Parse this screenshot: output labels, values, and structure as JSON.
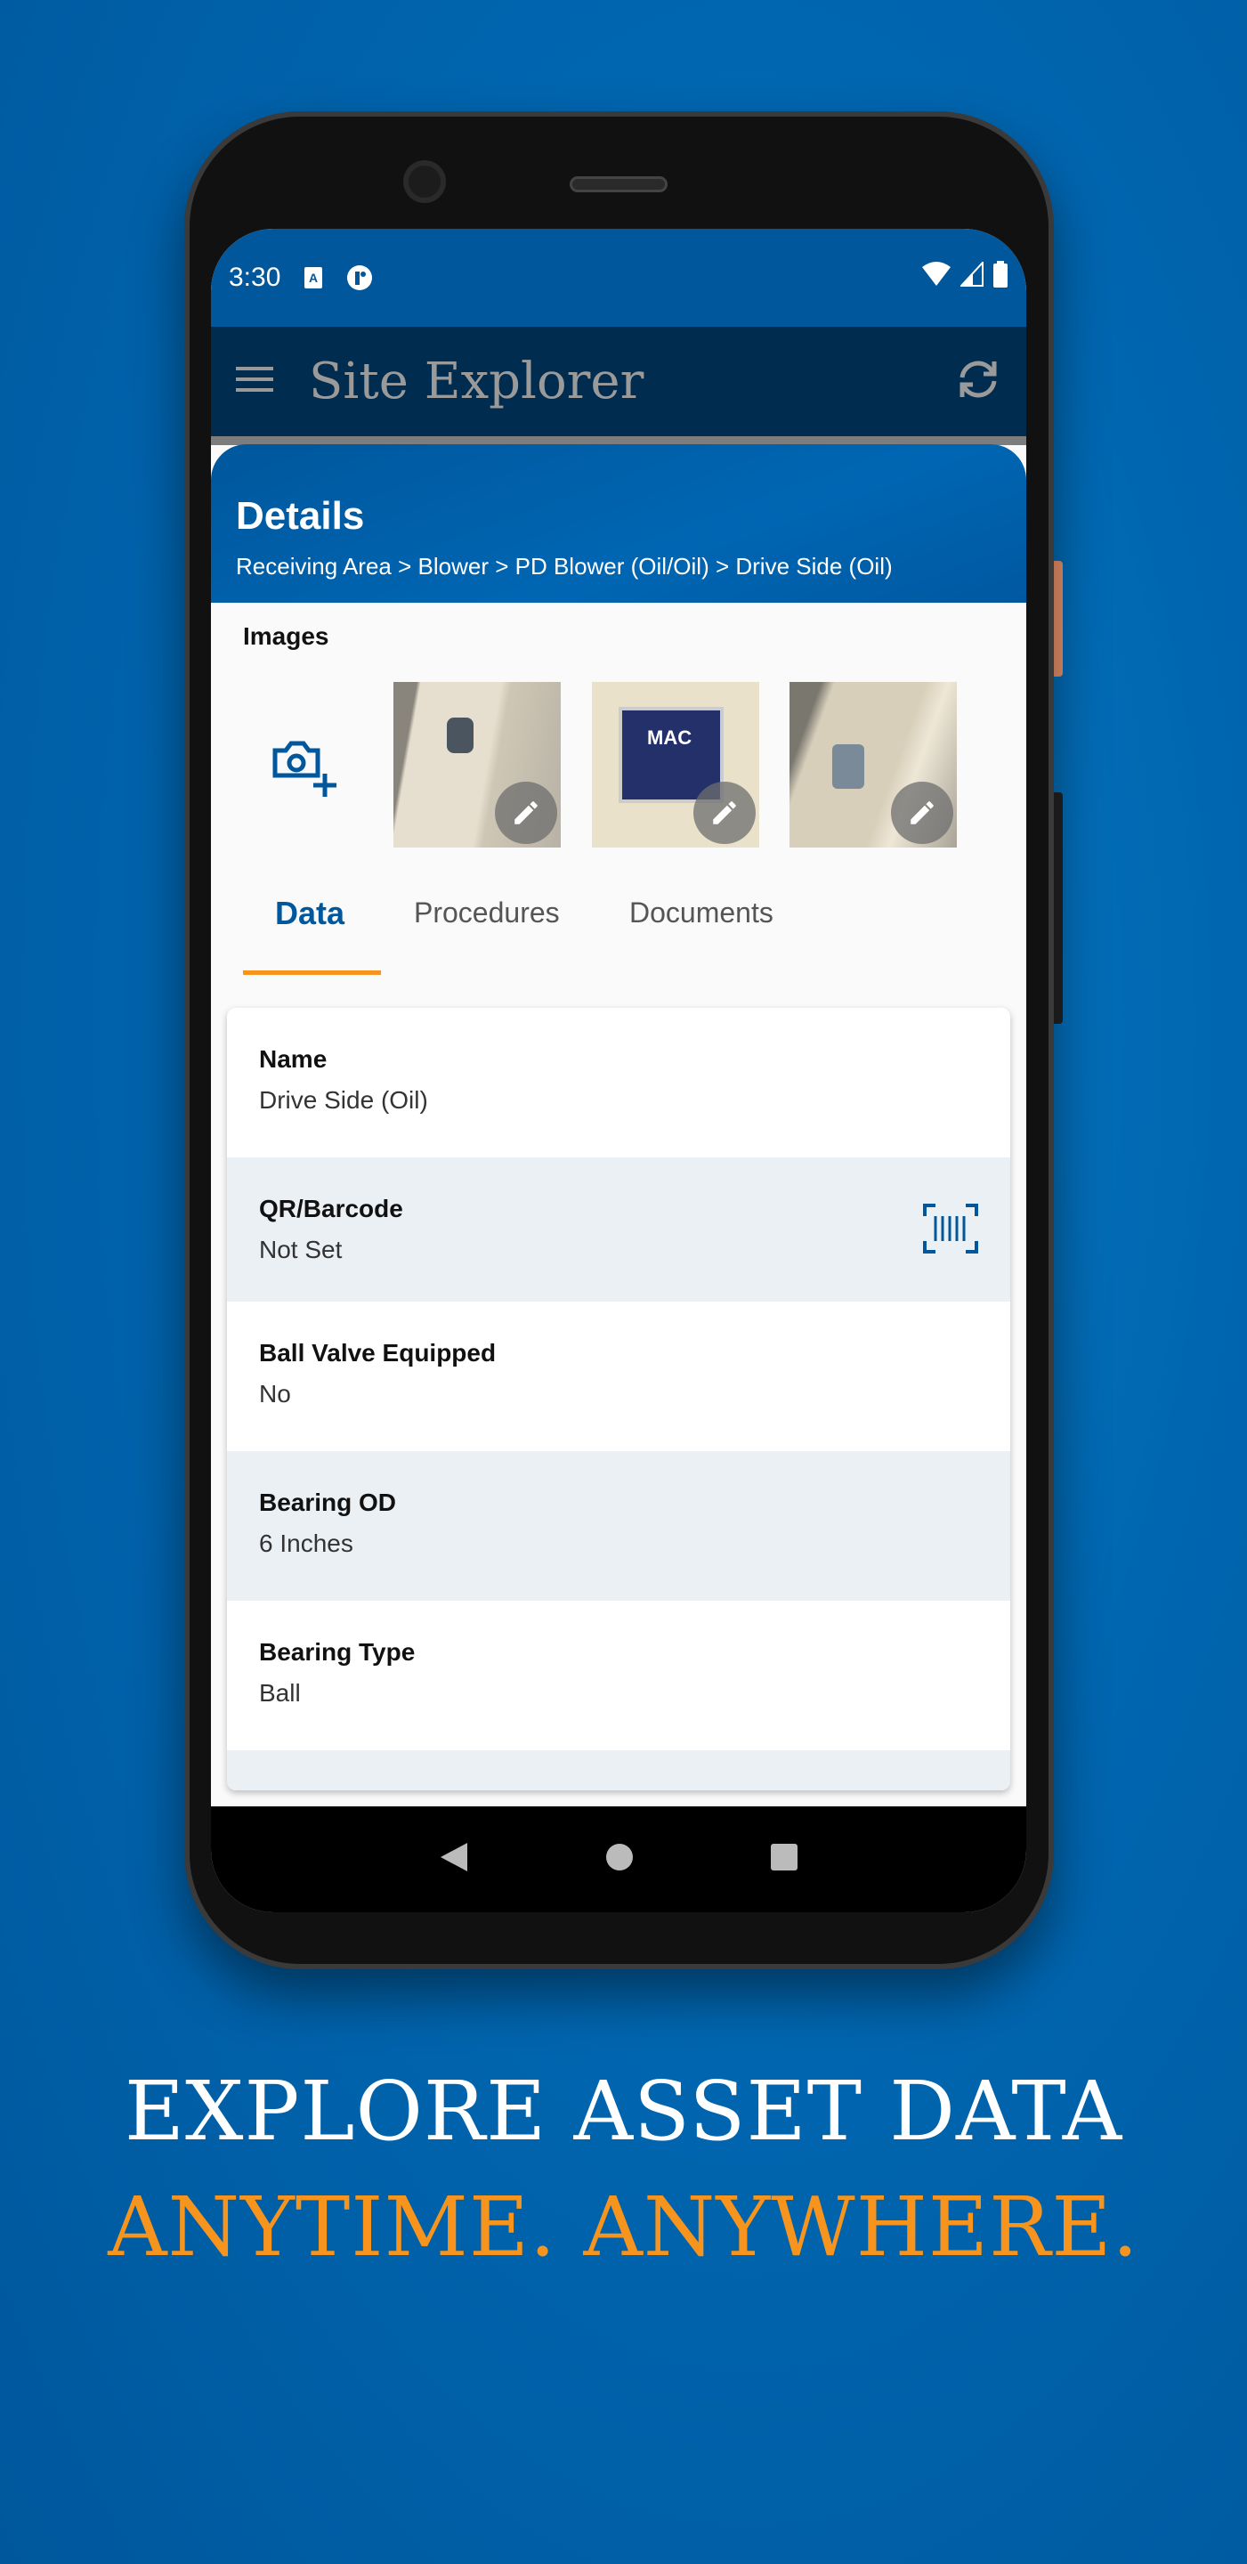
{
  "status_bar": {
    "time": "3:30",
    "icons": [
      "accessibility-a-icon",
      "app-notification-icon",
      "wifi-icon",
      "signal-icon",
      "battery-icon"
    ]
  },
  "app_bar": {
    "title": "Site Explorer",
    "menu_icon": "hamburger-icon",
    "sync_icon": "sync-icon"
  },
  "details": {
    "title": "Details",
    "breadcrumb": "Receiving Area > Blower > PD Blower (Oil/Oil) > Drive Side (Oil)"
  },
  "images": {
    "label": "Images",
    "add_icon": "add-photo-icon",
    "thumbnails": [
      {
        "alt": "blower drive side"
      },
      {
        "alt": "MAC equipment nameplate",
        "plate_text": "MAC"
      },
      {
        "alt": "blower bearing housing"
      }
    ]
  },
  "tabs": [
    {
      "label": "Data",
      "active": true
    },
    {
      "label": "Procedures"
    },
    {
      "label": "Documents"
    }
  ],
  "fields": [
    {
      "label": "Name",
      "value": "Drive Side (Oil)"
    },
    {
      "label": "QR/Barcode",
      "value": "Not Set",
      "icon": "barcode-scan-icon"
    },
    {
      "label": "Ball Valve Equipped",
      "value": "No"
    },
    {
      "label": "Bearing OD",
      "value": "6 Inches"
    },
    {
      "label": "Bearing Type",
      "value": "Ball"
    }
  ],
  "tagline": {
    "line1": "EXPLORE ASSET DATA",
    "line2": "ANYTIME. ANYWHERE."
  },
  "colors": {
    "primary": "#00579c",
    "appbar": "#002c50",
    "accent": "#f7941d"
  }
}
